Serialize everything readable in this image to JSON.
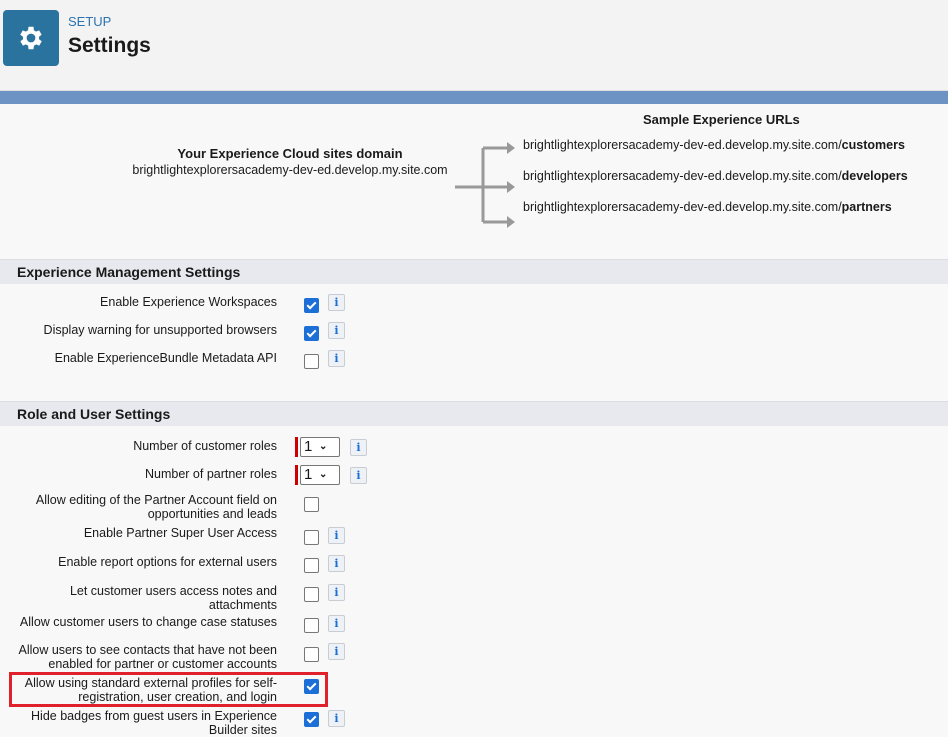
{
  "header": {
    "breadcrumb": "SETUP",
    "title": "Settings"
  },
  "domain": {
    "label": "Your Experience Cloud sites domain",
    "value": "brightlightexplorersacademy-dev-ed.develop.my.site.com"
  },
  "sample_urls": {
    "title": "Sample Experience URLs",
    "items": [
      {
        "base": "brightlightexplorersacademy-dev-ed.develop.my.site.com/",
        "path": "customers"
      },
      {
        "base": "brightlightexplorersacademy-dev-ed.develop.my.site.com/",
        "path": "developers"
      },
      {
        "base": "brightlightexplorersacademy-dev-ed.develop.my.site.com/",
        "path": "partners"
      }
    ]
  },
  "experience_management": {
    "title": "Experience Management Settings",
    "rows": [
      {
        "label": "Enable Experience Workspaces",
        "checked": true
      },
      {
        "label": "Display warning for unsupported browsers",
        "checked": true
      },
      {
        "label": "Enable ExperienceBundle Metadata API",
        "checked": false
      }
    ]
  },
  "role_user": {
    "title": "Role and User Settings",
    "customer_roles": {
      "label": "Number of customer roles",
      "value": "1"
    },
    "partner_roles": {
      "label": "Number of partner roles",
      "value": "1"
    },
    "rows": [
      {
        "label": "Allow editing of the Partner Account field on opportunities and leads",
        "checked": false
      },
      {
        "label": "Enable Partner Super User Access",
        "checked": false
      },
      {
        "label": "Enable report options for external users",
        "checked": false
      },
      {
        "label": "Let customer users access notes and attachments",
        "checked": false
      },
      {
        "label": "Allow customer users to change case statuses",
        "checked": false
      },
      {
        "label": "Allow users to see contacts that have not been enabled for partner or customer accounts",
        "checked": false
      },
      {
        "label": "Allow using standard external profiles for self-registration, user creation, and login",
        "checked": true
      },
      {
        "label": "Hide badges from guest users in Experience Builder sites",
        "checked": true
      }
    ]
  },
  "info_glyph": "i"
}
